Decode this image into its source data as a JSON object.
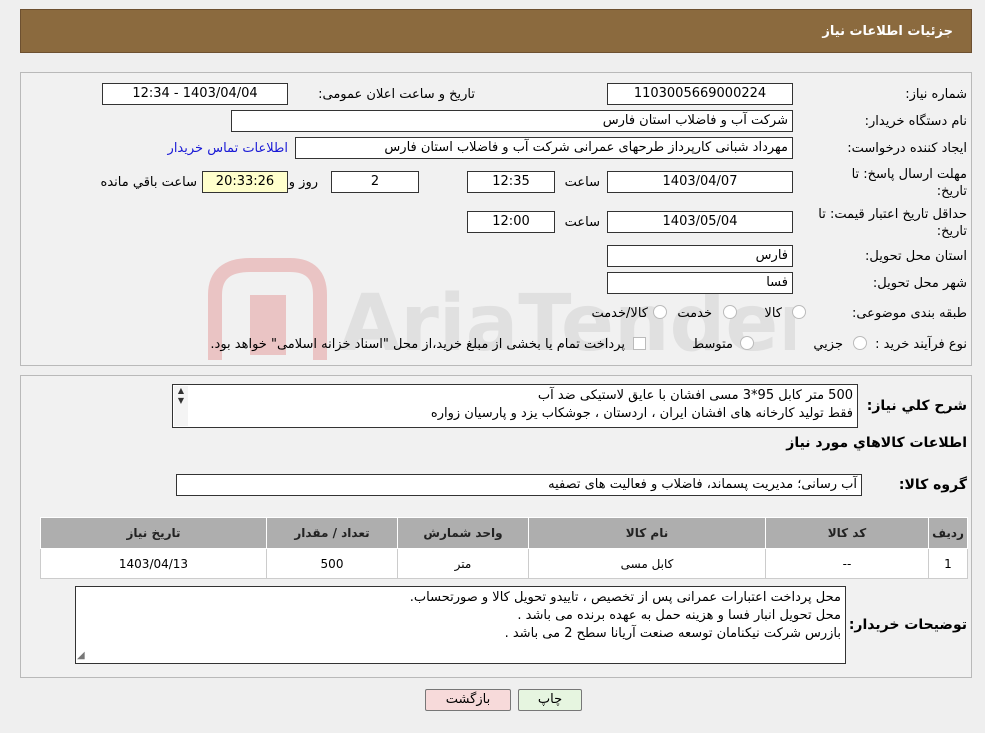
{
  "header": {
    "title": "جزئیات اطلاعات نیاز"
  },
  "form": {
    "need_number_label": "شماره نیاز:",
    "need_number": "1103005669000224",
    "announce_label": "تاریخ و ساعت اعلان عمومی:",
    "announce_value": "1403/04/04 - 12:34",
    "buyer_org_label": "نام دستگاه خریدار:",
    "buyer_org": "شرکت آب و فاضلاب استان فارس",
    "creator_label": "ایجاد کننده درخواست:",
    "creator": "مهرداد شبانی کارپرداز طرحهای عمرانی  شرکت آب و فاضلاب استان فارس",
    "contact_link": "اطلاعات تماس خریدار",
    "deadline_label": "مهلت ارسال پاسخ: تا تاریخ:",
    "deadline_date": "1403/04/07",
    "time_label": "ساعت",
    "deadline_time": "12:35",
    "days_value": "2",
    "days_label": "روز و",
    "remaining_time": "20:33:26",
    "remaining_label": "ساعت باقي مانده",
    "validity_label": "حداقل تاریخ اعتبار قیمت: تا تاریخ:",
    "validity_date": "1403/05/04",
    "validity_time": "12:00",
    "province_label": "استان محل تحویل:",
    "province": "فارس",
    "city_label": "شهر محل تحویل:",
    "city": "فسا",
    "category_label": "طبقه بندی موضوعی:",
    "category_options": [
      "کالا",
      "خدمت",
      "کالا/خدمت"
    ],
    "process_label": "نوع فرآیند خرید :",
    "process_options": [
      "جزيي",
      "متوسط"
    ],
    "payment_note": "پرداخت تمام یا بخشی از مبلغ خرید،از محل \"اسناد خزانه اسلامی\" خواهد بود."
  },
  "description": {
    "label": "شرح کلي نياز:",
    "text": "500 متر کابل 95*3 مسی افشان با عایق لاستیکی ضد آب\nفقط تولید کارخانه های افشان ایران ، اردستان ، جوشکاب یزد و پارسیان زواره"
  },
  "goods": {
    "section_title": "اطلاعات کالاهاي مورد نياز",
    "group_label": "گروه کالا:",
    "group_value": "آب رسانی؛ مدیریت پسماند، فاضلاب و فعالیت های تصفیه",
    "columns": [
      "رديف",
      "کد کالا",
      "نام کالا",
      "واحد شمارش",
      "تعداد / مقدار",
      "تاريخ نياز"
    ],
    "rows": [
      [
        "1",
        "--",
        "کابل مسی",
        "متر",
        "500",
        "1403/04/13"
      ]
    ]
  },
  "buyer_notes": {
    "label": "توضیحات خریدار:",
    "text": "محل پرداخت اعتبارات عمرانی پس از تخصیص ، تاییدو تحویل کالا و صورتحساب.\nمحل تحویل انبار فسا و هزینه حمل به عهده برنده می باشد .\nبازرس شرکت نیکنامان توسعه صنعت آریانا سطح 2 می باشد ."
  },
  "buttons": {
    "print": "چاپ",
    "back": "بازگشت"
  },
  "watermark": {
    "text": "AriaTender.neT"
  },
  "colors": {
    "header": "#8b6a3e",
    "link": "#1a1ad6",
    "back_button": "#f7dada",
    "print_button": "#e6f5e0"
  }
}
